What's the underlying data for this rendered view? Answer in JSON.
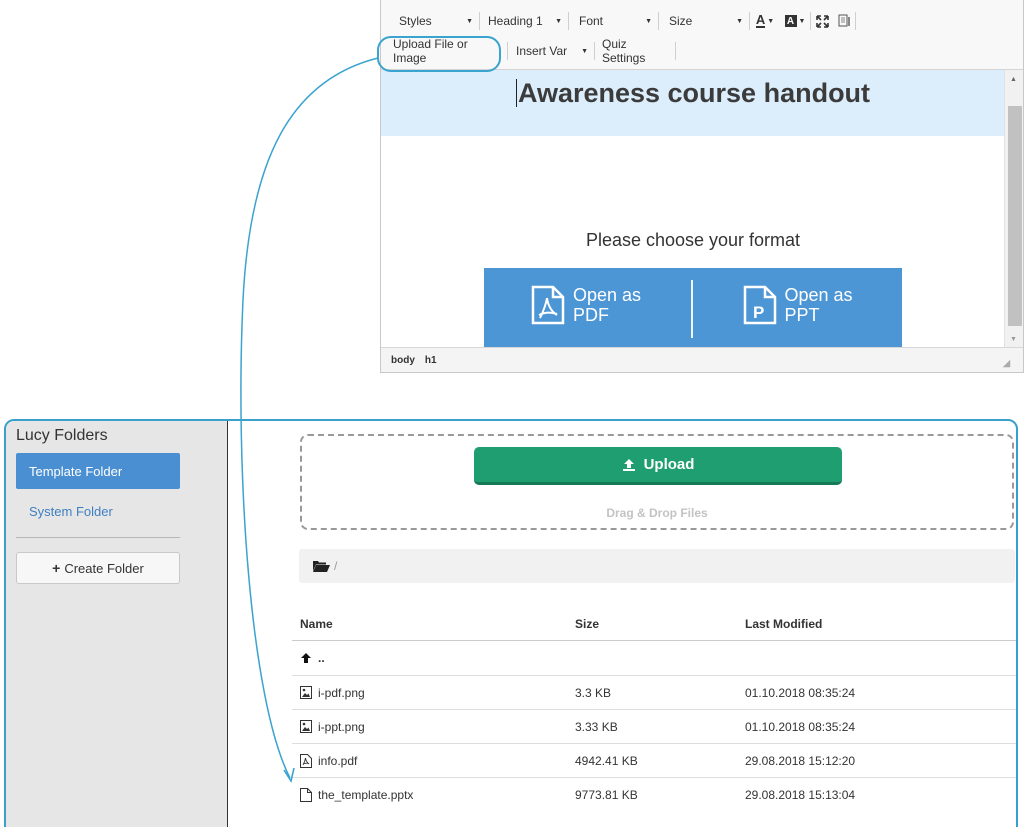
{
  "editor": {
    "toolbar": {
      "styles_label": "Styles",
      "heading_label": "Heading 1",
      "font_label": "Font",
      "size_label": "Size",
      "upload_label": "Upload File or Image",
      "insert_var_label": "Insert Var",
      "quiz_settings_label": "Quiz Settings"
    },
    "heading": "Awareness course handout",
    "choose_text": "Please choose your format",
    "open_pdf_label": "Open as PDF",
    "open_ppt_label": "Open as PPT",
    "status": [
      "body",
      "h1"
    ]
  },
  "file_manager": {
    "sidebar": {
      "title": "Lucy Folders",
      "template_folder": "Template Folder",
      "system_folder": "System Folder",
      "create_folder": "Create Folder"
    },
    "upload_label": "Upload",
    "drag_drop_text": "Drag & Drop Files",
    "path": "/",
    "table": {
      "headers": [
        "Name",
        "Size",
        "Last Modified"
      ],
      "parent": "..",
      "rows": [
        {
          "name": "i-pdf.png",
          "size": "3.3 KB",
          "modified": "01.10.2018 08:35:24",
          "icon": "image-file-icon"
        },
        {
          "name": "i-ppt.png",
          "size": "3.33 KB",
          "modified": "01.10.2018 08:35:24",
          "icon": "image-file-icon"
        },
        {
          "name": "info.pdf",
          "size": "4942.41 KB",
          "modified": "29.08.2018 15:12:20",
          "icon": "pdf-file-icon"
        },
        {
          "name": "the_template.pptx",
          "size": "9773.81 KB",
          "modified": "29.08.2018 15:13:04",
          "icon": "file-icon"
        }
      ]
    }
  },
  "colors": {
    "accent_blue": "#4c96d6",
    "callout": "#3aa3cf",
    "upload_green": "#1f9e72"
  }
}
